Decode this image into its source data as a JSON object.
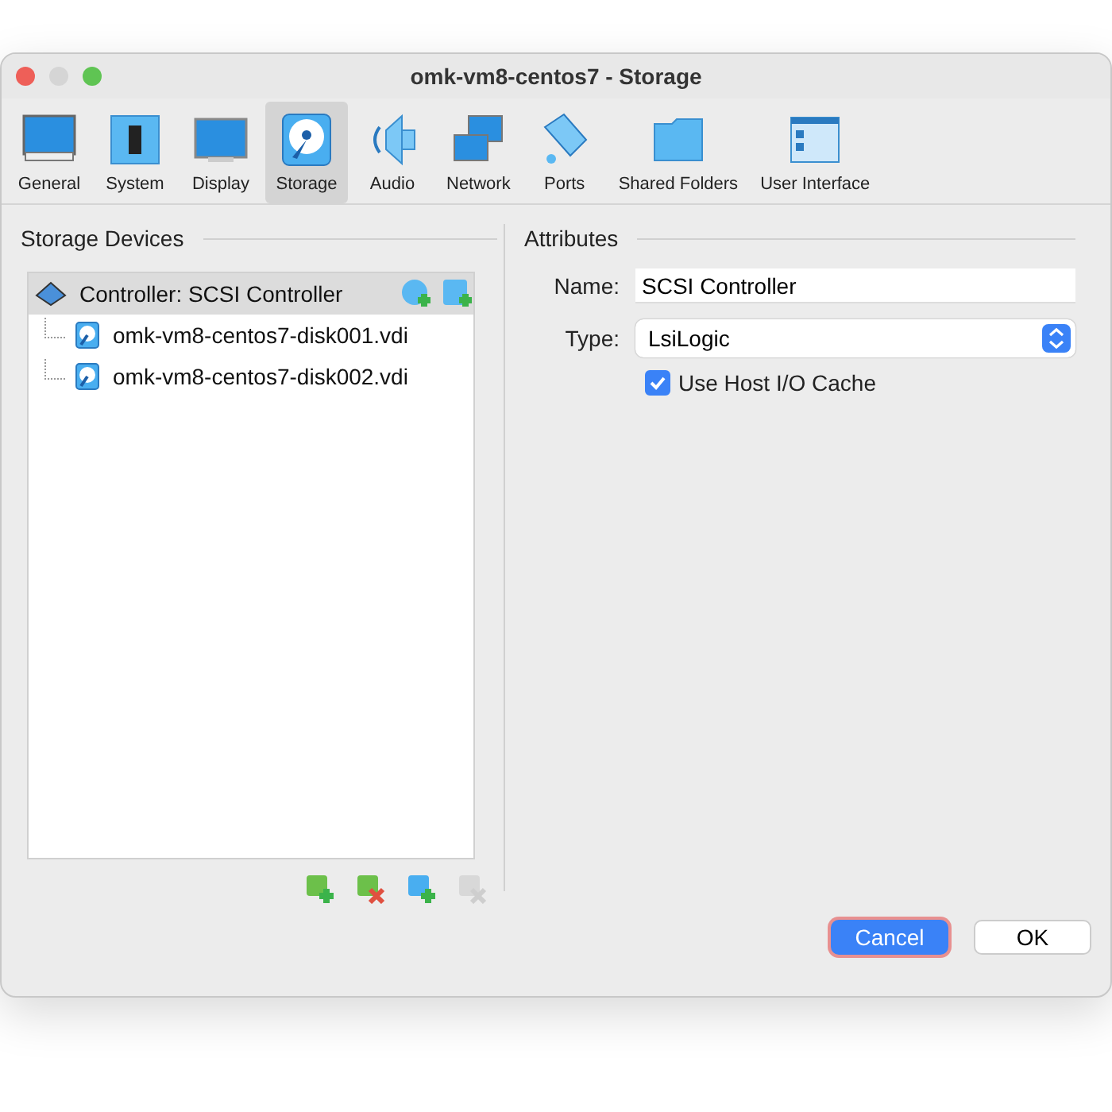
{
  "window": {
    "title": "omk-vm8-centos7 - Storage"
  },
  "toolbar": [
    {
      "label": "General",
      "kind": "monitor",
      "selected": false
    },
    {
      "label": "System",
      "kind": "chip",
      "selected": false
    },
    {
      "label": "Display",
      "kind": "display",
      "selected": false
    },
    {
      "label": "Storage",
      "kind": "disk",
      "selected": true
    },
    {
      "label": "Audio",
      "kind": "speaker",
      "selected": false
    },
    {
      "label": "Network",
      "kind": "network",
      "selected": false
    },
    {
      "label": "Ports",
      "kind": "ports",
      "selected": false
    },
    {
      "label": "Shared Folders",
      "kind": "folder",
      "selected": false
    },
    {
      "label": "User Interface",
      "kind": "ui",
      "selected": false
    }
  ],
  "storage_devices": {
    "title": "Storage Devices",
    "tree": [
      {
        "label": "Controller: SCSI Controller",
        "selected": true,
        "children": [
          {
            "label": "omk-vm8-centos7-disk001.vdi",
            "selected": false
          },
          {
            "label": "omk-vm8-centos7-disk002.vdi",
            "selected": false
          }
        ]
      }
    ],
    "actions": [
      {
        "kind": "add",
        "disabled": false
      },
      {
        "kind": "remove",
        "disabled": false
      },
      {
        "kind": "add",
        "disabled": false
      },
      {
        "kind": "remove",
        "disabled": true
      }
    ]
  },
  "attributes": {
    "title": "Attributes",
    "name_label": "Name:",
    "name_value": "SCSI Controller",
    "type_label": "Type:",
    "type_value": "LsiLogic",
    "host_cache": {
      "label": "Use Host I/O Cache",
      "checked": true
    }
  },
  "buttons": [
    {
      "label": "Cancel",
      "default": true
    },
    {
      "label": "OK",
      "default": false
    }
  ]
}
